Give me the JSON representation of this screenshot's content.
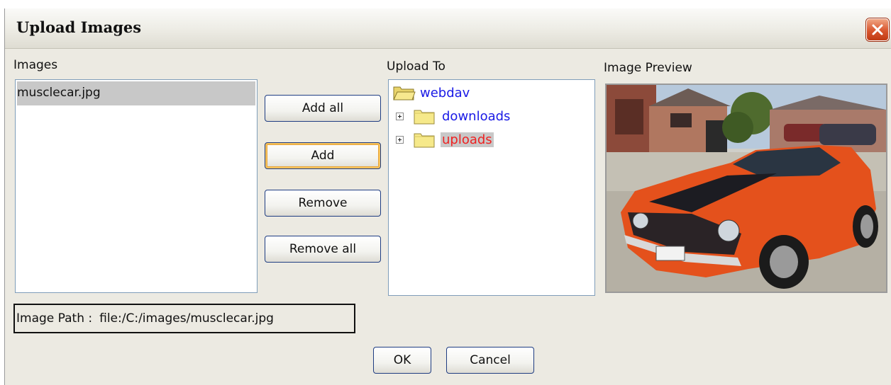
{
  "dialog": {
    "title": "Upload Images"
  },
  "images": {
    "label": "Images",
    "items": [
      "musclecar.jpg"
    ]
  },
  "actions": {
    "add_all": "Add all",
    "add": "Add",
    "remove": "Remove",
    "remove_all": "Remove all"
  },
  "upload_to": {
    "label": "Upload To",
    "root": "webdav",
    "folders": [
      {
        "name": "downloads",
        "selected": false
      },
      {
        "name": "uploads",
        "selected": true
      }
    ]
  },
  "preview": {
    "label": "Image Preview"
  },
  "path": {
    "label": "Image Path :",
    "value": "file:/C:/images/musclecar.jpg"
  },
  "footer": {
    "ok": "OK",
    "cancel": "Cancel"
  },
  "colors": {
    "link": "#1a1ae6",
    "selected_link": "#ee2222",
    "selection_bg": "#c8c8c8",
    "close_red": "#d9552d"
  }
}
